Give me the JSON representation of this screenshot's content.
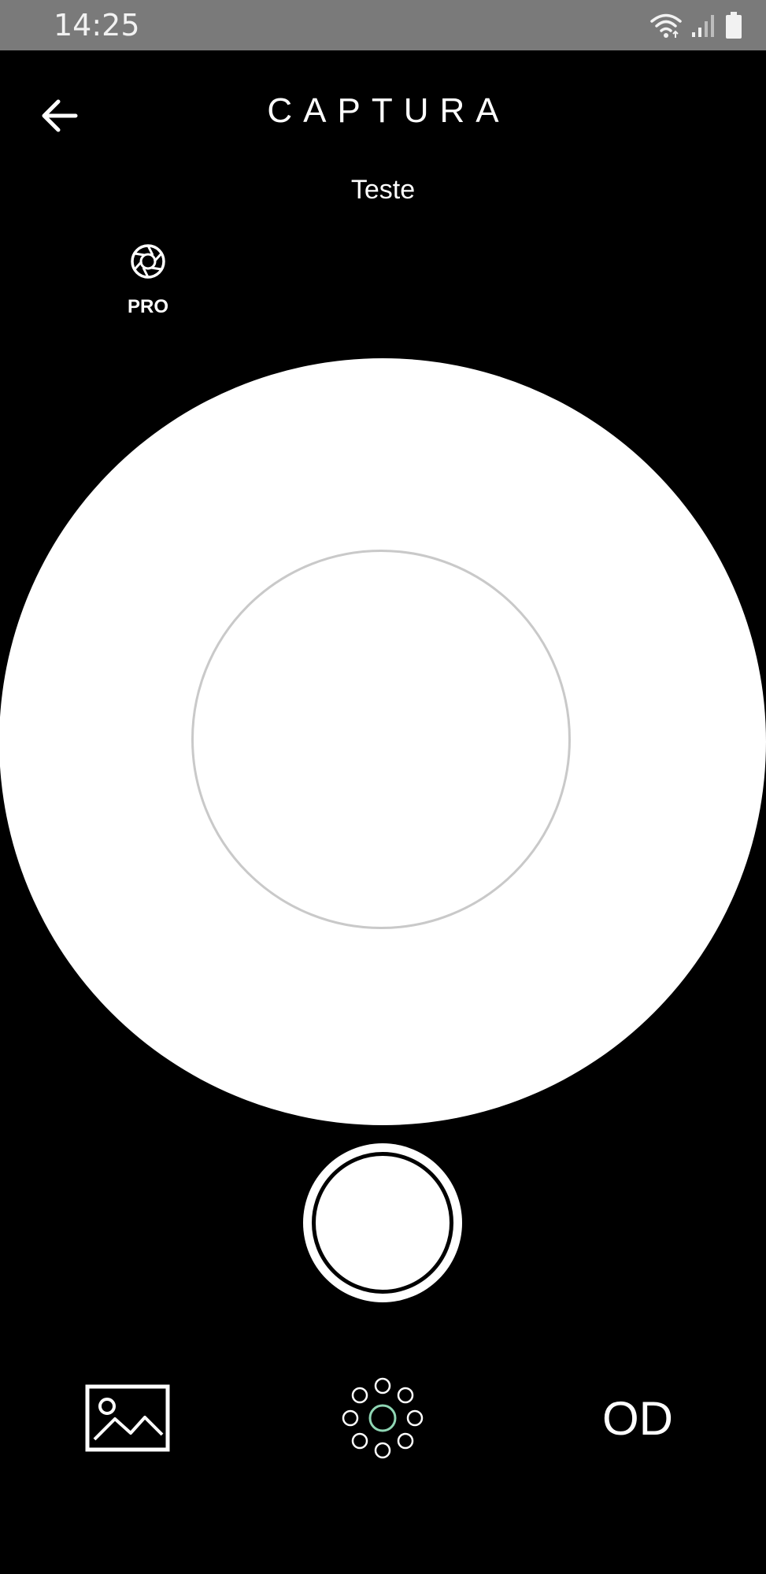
{
  "status_bar": {
    "time": "14:25",
    "icons": [
      "wifi-icon",
      "signal-icon",
      "battery-icon"
    ]
  },
  "header": {
    "title": "CAPTURA",
    "back_icon": "arrow-left-icon"
  },
  "subtitle": "Teste",
  "pro_mode": {
    "icon": "aperture-icon",
    "label": "PRO"
  },
  "capture": {
    "shutter_icon": "shutter-button"
  },
  "bottom_bar": {
    "gallery_icon": "gallery-icon",
    "pattern_icon": "led-pattern-icon",
    "eye_label": "OD"
  },
  "colors": {
    "background": "#000000",
    "status_bar": "#7a7a7a",
    "viewfinder": "#ffffff",
    "target_ring": "#c9c9c9",
    "pattern_accent": "#8fd6b4"
  }
}
